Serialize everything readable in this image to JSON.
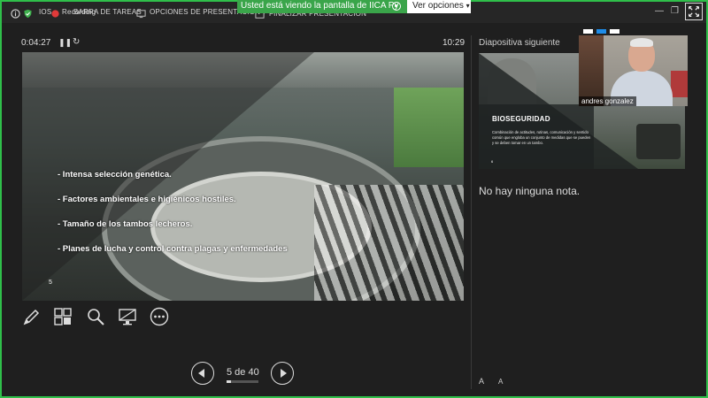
{
  "topbar": {
    "left_partial": "IOS",
    "recording": "Recording",
    "taskbar_partial": "BARRA DE TAREAS",
    "presenter_options": "OPCIONES DE PRESENTACIÓN ▾",
    "end_presentation": "FINALIZAR PRESENTACIÓN"
  },
  "share": {
    "banner": "Usted está viendo la pantalla de IICA Py",
    "view_options": "Ver opciones"
  },
  "presenter": {
    "timer": "0:04:27",
    "clock": "10:29",
    "pause_glyph": "❚❚",
    "restart_glyph": "↻"
  },
  "current_slide": {
    "bullets": [
      "-  Intensa selección genética.",
      "-  Factores ambientales e higiénicos hostiles.",
      "-  Tamaño de los tambos lecheros.",
      "-   Planes de lucha y control contra plagas y enfermedades"
    ],
    "number": "5"
  },
  "tools": [
    {
      "icon": "pen-icon"
    },
    {
      "icon": "see-all-slides-icon"
    },
    {
      "icon": "zoom-icon"
    },
    {
      "icon": "black-screen-icon"
    },
    {
      "icon": "more-options-icon"
    }
  ],
  "nav": {
    "counter": "5 de 40",
    "progress": 0.125
  },
  "next_slide": {
    "label": "Diapositiva siguiente",
    "title": "BIOSEGURIDAD",
    "body": "Combinación de actitudes, rutinas, comunicación y sentido común que engloba un conjunto de medidas que se pueden y se deben tomar en un tambo.",
    "number": "6"
  },
  "notes": {
    "text": "No hay ninguna nota.",
    "font_increase": "A",
    "font_decrease": "A"
  },
  "video": {
    "participant": "andres gonzalez"
  },
  "colors": {
    "frame": "#2fbf4a",
    "banner": "#3aa54a",
    "background": "#1f1f1f"
  }
}
